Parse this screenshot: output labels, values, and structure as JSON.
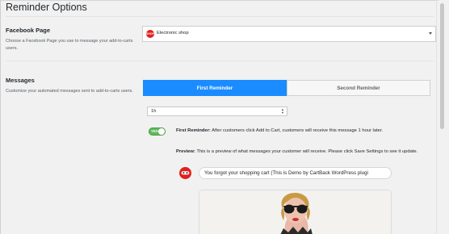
{
  "page": {
    "title": "Reminder Options"
  },
  "facebook_page": {
    "title": "Facebook Page",
    "description": "Choose a Facebook Page you use to message your add-to-carts users.",
    "selected_page": "Electronic shop",
    "logo_text": "SHOP",
    "logo_color": "#e0201e"
  },
  "messages": {
    "title": "Messages",
    "description": "Customize your automated messages sent to add-to-carts users.",
    "tabs": [
      {
        "label": "First Reminder",
        "active": true
      },
      {
        "label": "Second Reminder",
        "active": false
      }
    ],
    "delay_value": "1h",
    "toggle_label": "YES",
    "toggle_on": true,
    "reminder_label": "First Reminder:",
    "reminder_text": "After customers click Add to Cart, customers will receive this message 1 hour later.",
    "preview_label": "Preview:",
    "preview_text": "This is a preview of what messages your customer will receive. Please click Save Settings to see it update.",
    "message_text": "You forgot your shopping cart (This is Demo by CartBack WordPress plugi"
  },
  "colors": {
    "accent": "#1a8cff",
    "toggle_on": "#5cb85c",
    "brand_red": "#e0201e"
  }
}
